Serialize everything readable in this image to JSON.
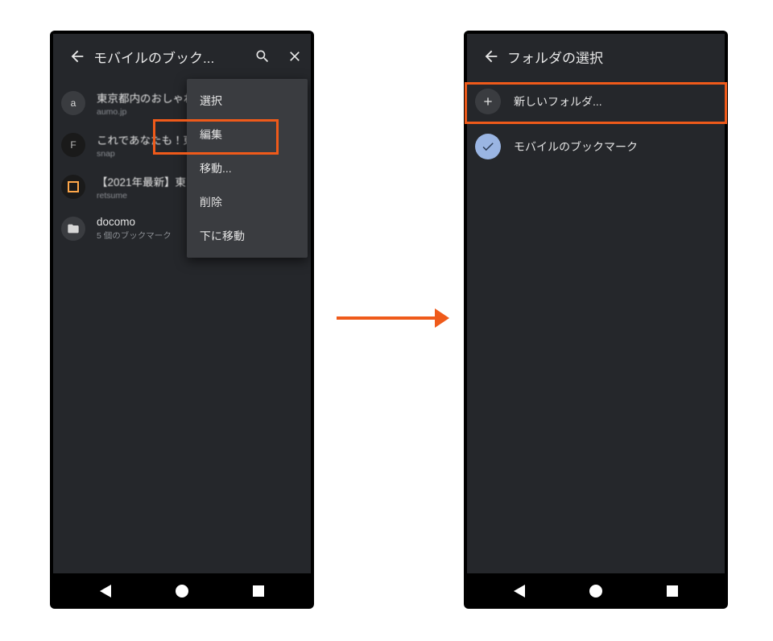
{
  "left": {
    "title": "モバイルのブック...",
    "bookmarks": [
      {
        "title": "東京都内のおしゃれ・・・",
        "sub": "aumo.jp"
      },
      {
        "title": "これであなたも！東京・・・",
        "sub": "snap"
      },
      {
        "title": "【2021年最新】東・・・",
        "sub": "retsume"
      },
      {
        "title": "docomo",
        "sub": "5 個のブックマーク"
      }
    ],
    "menu": {
      "select": "選択",
      "edit": "編集",
      "move": "移動...",
      "delete": "削除",
      "movedown": "下に移動"
    }
  },
  "right": {
    "title": "フォルダの選択",
    "new_folder": "新しいフォルダ...",
    "mobile_bookmarks": "モバイルのブックマーク"
  }
}
